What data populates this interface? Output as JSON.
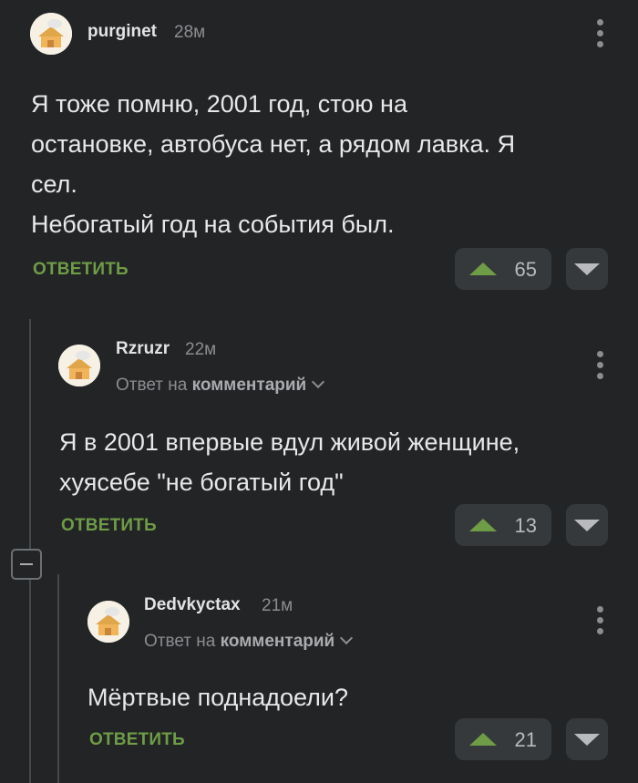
{
  "comments": [
    {
      "username": "purginet",
      "time": "28м",
      "text": "Я тоже помню, 2001 год, стою на\nостановке, автобуса нет, а рядом лавка. Я\nсел.\nНебогатый год на события был.",
      "reply_label": "ОТВЕТИТЬ",
      "votes": "65"
    },
    {
      "username": "Rzruzr",
      "time": "22м",
      "reply_to_prefix": "Ответ на",
      "reply_to_target": "комментарий",
      "text": "Я в 2001 впервые вдул живой женщине,\nхуясебе \"не богатый год\"",
      "reply_label": "ОТВЕТИТЬ",
      "votes": "13"
    },
    {
      "username": "Dedvkyctax",
      "time": "21м",
      "reply_to_prefix": "Ответ на",
      "reply_to_target": "комментарий",
      "text": "Мёртвые поднадоели?",
      "reply_label": "ОТВЕТИТЬ",
      "votes": "21"
    }
  ],
  "colors": {
    "background": "#222426",
    "accent_green": "#6f9c46",
    "button_bg": "#36393c",
    "muted_text": "#8b8d90"
  },
  "icons": [
    "avatar-house-icon",
    "more-vertical-icon",
    "upvote-arrow-icon",
    "downvote-arrow-icon",
    "chevron-down-icon",
    "collapse-minus-icon"
  ]
}
